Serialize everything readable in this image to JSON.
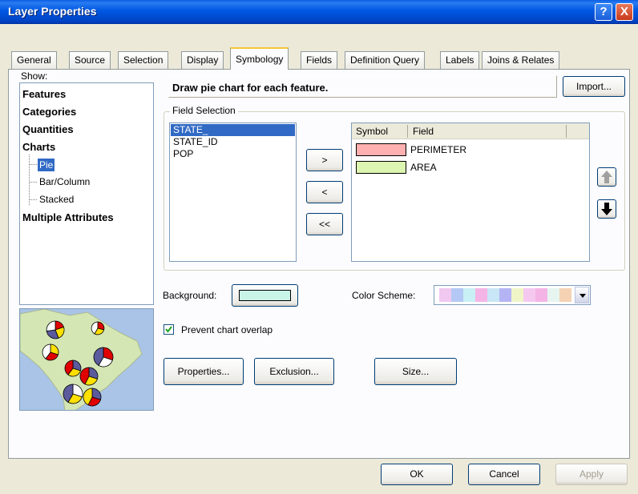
{
  "window": {
    "title": "Layer Properties",
    "help": "?",
    "close": "X"
  },
  "tabs": [
    "General",
    "Source",
    "Selection",
    "Display",
    "Symbology",
    "Fields",
    "Definition Query",
    "Labels",
    "Joins & Relates"
  ],
  "active_tab": "Symbology",
  "show": {
    "label": "Show:",
    "items": [
      "Features",
      "Categories",
      "Quantities",
      "Charts",
      "Pie",
      "Bar/Column",
      "Stacked",
      "Multiple Attributes"
    ],
    "selected": "Pie"
  },
  "symbology": {
    "description": "Draw pie chart for each feature.",
    "import_label": "Import...",
    "field_selection_label": "Field Selection",
    "available_fields": [
      "STATE_",
      "STATE_ID",
      "POP"
    ],
    "selected_available": "STATE_",
    "move_right": ">",
    "move_left": "<",
    "move_all_left": "<<",
    "symbol_col": "Symbol",
    "field_col": "Field",
    "chosen_fields": [
      {
        "name": "PERIMETER",
        "color": "#ffb0b0"
      },
      {
        "name": "AREA",
        "color": "#dcf5b0"
      }
    ],
    "background_label": "Background:",
    "background_color": "#c8f5e8",
    "color_scheme_label": "Color Scheme:",
    "color_scheme": [
      "#f0c8f0",
      "#b4c8f5",
      "#c8f0f5",
      "#f5b4e6",
      "#c8e6f5",
      "#b4b4f5",
      "#f0f5c8",
      "#f5c8f0",
      "#f5b4e6",
      "#e6f5f0",
      "#f5d2b4"
    ],
    "prevent_overlap_label": "Prevent chart overlap",
    "prevent_overlap_checked": true,
    "properties_label": "Properties...",
    "exclusion_label": "Exclusion...",
    "size_label": "Size..."
  },
  "footer": {
    "ok": "OK",
    "cancel": "Cancel",
    "apply": "Apply"
  }
}
